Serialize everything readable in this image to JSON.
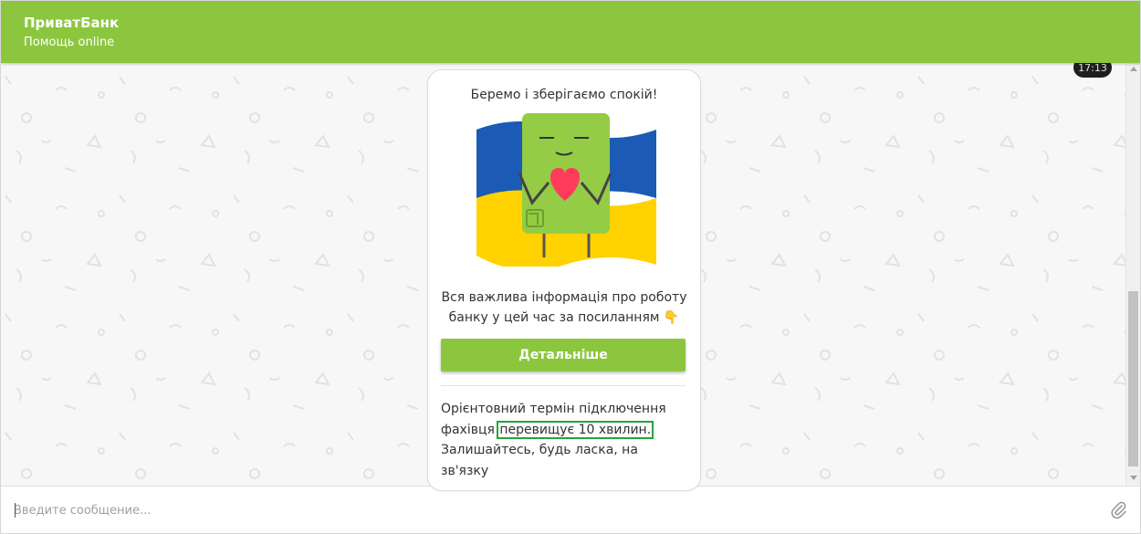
{
  "header": {
    "title": "ПриватБанк",
    "status": "Помощь online"
  },
  "chat": {
    "time_badge": "17:13"
  },
  "card": {
    "heading": "Беремо і зберігаємо спокій!",
    "text_line1": "Вся важлива інформація про роботу",
    "text_line2": "банку у цей час за посиланням 👇",
    "button_label": "Детальніше",
    "wait_before": "Орієнтовний термін підключення фахівця ",
    "wait_highlight": "перевищує 10 хвилин.",
    "wait_after": "Залишайтесь, будь ласка, на зв'язку"
  },
  "input": {
    "placeholder": "Введите сообщение..."
  },
  "colors": {
    "brand_green": "#8cc63f",
    "highlight_box": "#22a63c",
    "flag_blue": "#1c5bb5",
    "flag_yellow": "#ffd200"
  },
  "icons": {
    "attach": "paperclip-icon"
  }
}
